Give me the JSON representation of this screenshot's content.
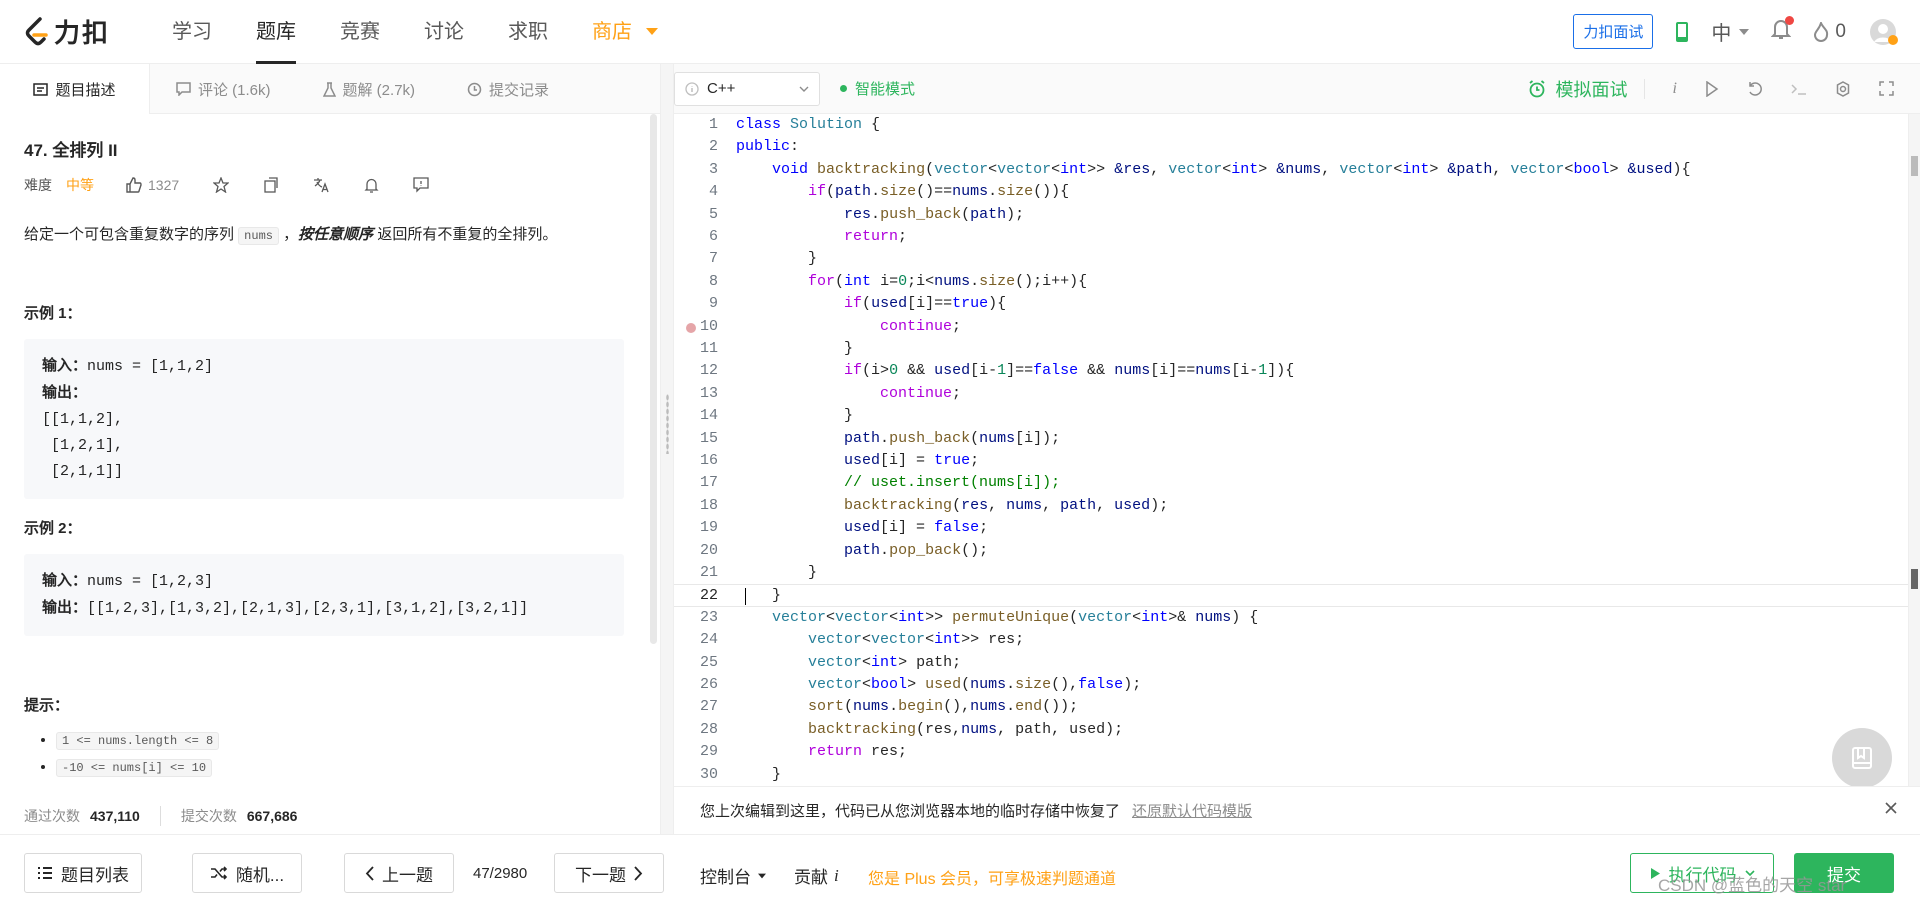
{
  "nav": {
    "logo_text": "力扣",
    "items": [
      "学习",
      "题库",
      "竞赛",
      "讨论",
      "求职"
    ],
    "store": "商店",
    "interview": "力扣面试",
    "lang": "中",
    "coins": "0"
  },
  "left_tabs": [
    {
      "label": "题目描述",
      "icon": "description-icon"
    },
    {
      "label": "评论 (1.6k)",
      "icon": "comment-icon"
    },
    {
      "label": "题解 (2.7k)",
      "icon": "solution-flask-icon"
    },
    {
      "label": "提交记录",
      "icon": "history-clock-icon"
    }
  ],
  "problem": {
    "title": "47. 全排列 II",
    "difficulty_label": "难度",
    "difficulty": "中等",
    "likes": "1327",
    "desc_pre": "给定一个可包含重复数字的序列 ",
    "desc_code": "nums",
    "desc_mid": " ，",
    "desc_bold": "按任意顺序",
    "desc_post": " 返回所有不重复的全排列。",
    "example1_title": "示例 1：",
    "example1_in_label": "输入：",
    "example1_in": "nums = [1,1,2]",
    "example1_out_label": "输出：",
    "example1_out_lines": "[[1,1,2],\n [1,2,1],\n [2,1,1]]",
    "example2_title": "示例 2：",
    "example2_in_label": "输入：",
    "example2_in": "nums = [1,2,3]",
    "example2_out_label": "输出：",
    "example2_out": "[[1,2,3],[1,3,2],[2,1,3],[2,3,1],[3,1,2],[3,2,1]]",
    "hint_title": "提示：",
    "hints": [
      "1 <= nums.length <= 8",
      "-10 <= nums[i] <= 10"
    ],
    "accepted_label": "通过次数",
    "accepted": "437,110",
    "submissions_label": "提交次数",
    "submissions": "667,686"
  },
  "editor": {
    "language": "C++",
    "smart_mode": "智能模式",
    "mock_interview": "模拟面试",
    "restore_msg": "您上次编辑到这里，代码已从您浏览器本地的临时存储中恢复了",
    "restore_link": "还原默认代码模版",
    "breakpoint_line": 10,
    "current_line": 22
  },
  "bottom": {
    "problem_list": "题目列表",
    "random": "随机...",
    "prev": "上一题",
    "pager": "47/2980",
    "next": "下一题",
    "console": "控制台",
    "contribute": "贡献",
    "plus_note": "您是 Plus 会员，可享极速判题通道",
    "run": "执行代码",
    "submit": "提交",
    "watermark": "CSDN @蓝色的天空    star"
  },
  "colors": {
    "accent_orange": "#ffa116",
    "accent_green": "#2db55d",
    "blue": "#1a6fe8"
  }
}
